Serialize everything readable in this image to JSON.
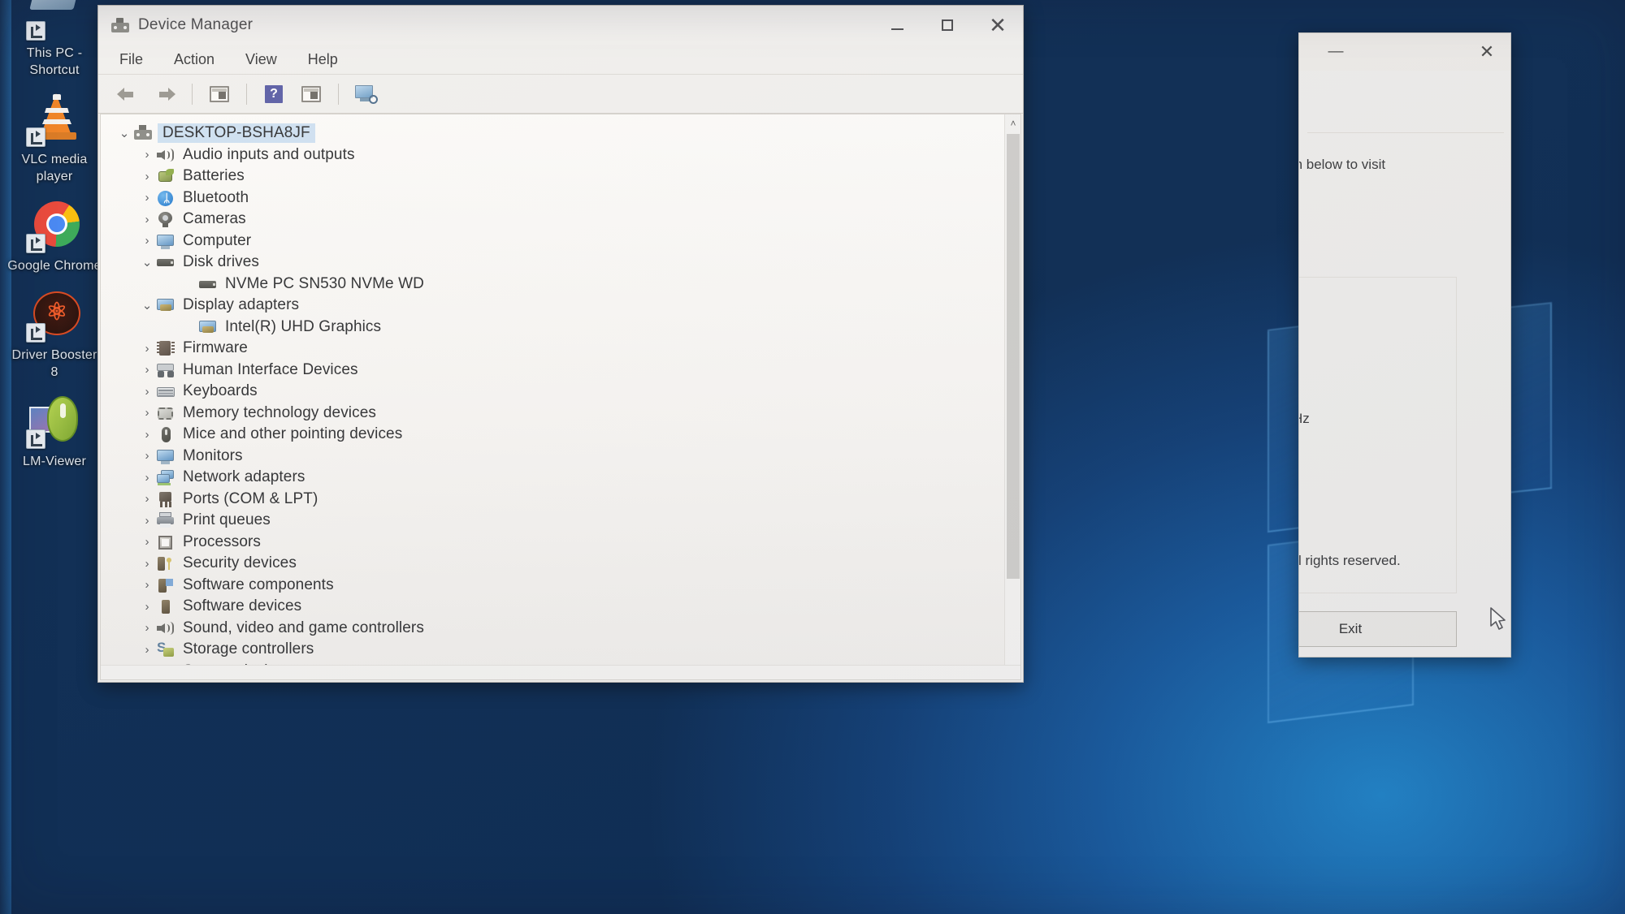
{
  "desktop": {
    "icons": [
      {
        "label": "This PC - Shortcut",
        "icon": "this-pc-icon"
      },
      {
        "label": "VLC media player",
        "icon": "vlc-icon"
      },
      {
        "label": "Google Chrome",
        "icon": "chrome-icon"
      },
      {
        "label": "Driver Booster 8",
        "icon": "driver-booster-icon"
      },
      {
        "label": "LM-Viewer",
        "icon": "lm-viewer-icon"
      }
    ]
  },
  "device_manager": {
    "title": "Device Manager",
    "title_icon": "device-manager-icon",
    "window_buttons": {
      "minimize": "—",
      "maximize": "□",
      "close": "✕"
    },
    "menu": [
      {
        "label": "File"
      },
      {
        "label": "Action"
      },
      {
        "label": "View"
      },
      {
        "label": "Help"
      }
    ],
    "toolbar": [
      {
        "name": "back-button",
        "icon": "back-arrow-icon"
      },
      {
        "name": "forward-button",
        "icon": "forward-arrow-icon"
      },
      {
        "name": "properties-button",
        "icon": "properties-icon"
      },
      {
        "name": "help-button",
        "icon": "help-icon"
      },
      {
        "name": "update-driver-button",
        "icon": "update-driver-icon"
      },
      {
        "name": "scan-hardware-button",
        "icon": "scan-hardware-icon"
      }
    ],
    "tree": [
      {
        "label": "DESKTOP-BSHA8JF",
        "level": 0,
        "state": "expanded",
        "icon": "computer-node-icon",
        "selected": true
      },
      {
        "label": "Audio inputs and outputs",
        "level": 1,
        "state": "collapsed",
        "icon": "speaker-icon"
      },
      {
        "label": "Batteries",
        "level": 1,
        "state": "collapsed",
        "icon": "battery-icon"
      },
      {
        "label": "Bluetooth",
        "level": 1,
        "state": "collapsed",
        "icon": "bluetooth-icon"
      },
      {
        "label": "Cameras",
        "level": 1,
        "state": "collapsed",
        "icon": "camera-icon"
      },
      {
        "label": "Computer",
        "level": 1,
        "state": "collapsed",
        "icon": "monitor-icon"
      },
      {
        "label": "Disk drives",
        "level": 1,
        "state": "expanded",
        "icon": "disk-icon"
      },
      {
        "label": "NVMe PC SN530 NVMe WD",
        "level": 2,
        "state": "leaf",
        "icon": "disk-icon"
      },
      {
        "label": "Display adapters",
        "level": 1,
        "state": "expanded",
        "icon": "display-adapter-icon"
      },
      {
        "label": "Intel(R) UHD Graphics",
        "level": 2,
        "state": "leaf",
        "icon": "display-adapter-icon"
      },
      {
        "label": "Firmware",
        "level": 1,
        "state": "collapsed",
        "icon": "chip-icon"
      },
      {
        "label": "Human Interface Devices",
        "level": 1,
        "state": "collapsed",
        "icon": "hid-icon"
      },
      {
        "label": "Keyboards",
        "level": 1,
        "state": "collapsed",
        "icon": "keyboard-icon"
      },
      {
        "label": "Memory technology devices",
        "level": 1,
        "state": "collapsed",
        "icon": "memory-technology-icon"
      },
      {
        "label": "Mice and other pointing devices",
        "level": 1,
        "state": "collapsed",
        "icon": "mouse-icon"
      },
      {
        "label": "Monitors",
        "level": 1,
        "state": "collapsed",
        "icon": "monitor-icon"
      },
      {
        "label": "Network adapters",
        "level": 1,
        "state": "collapsed",
        "icon": "network-adapter-icon"
      },
      {
        "label": "Ports (COM & LPT)",
        "level": 1,
        "state": "collapsed",
        "icon": "port-icon"
      },
      {
        "label": "Print queues",
        "level": 1,
        "state": "collapsed",
        "icon": "printer-icon"
      },
      {
        "label": "Processors",
        "level": 1,
        "state": "collapsed",
        "icon": "cpu-icon"
      },
      {
        "label": "Security devices",
        "level": 1,
        "state": "collapsed",
        "icon": "security-icon"
      },
      {
        "label": "Software components",
        "level": 1,
        "state": "collapsed",
        "icon": "software-component-icon"
      },
      {
        "label": "Software devices",
        "level": 1,
        "state": "collapsed",
        "icon": "software-device-icon"
      },
      {
        "label": "Sound, video and game controllers",
        "level": 1,
        "state": "collapsed",
        "icon": "speaker-icon"
      },
      {
        "label": "Storage controllers",
        "level": 1,
        "state": "collapsed",
        "icon": "storage-controller-icon"
      },
      {
        "label": "System devices",
        "level": 1,
        "state": "collapsed",
        "icon": "system-device-icon"
      }
    ],
    "twisty_glyphs": {
      "collapsed": "›",
      "expanded": "⌄"
    },
    "scrollbar": {
      "up": "˄",
      "down": "˅"
    }
  },
  "background_window": {
    "minimize": "—",
    "close": "✕",
    "text_visit": "\" button below to visit",
    "text_hz": "Hz",
    "text_rights": "soft. All rights reserved.",
    "exit_label": "Exit"
  },
  "colors": {
    "selection_blue": "#cfe1f2",
    "window_face": "#f1f0ee",
    "desktop_blue": "#1d4478",
    "text_dark": "#2f3032"
  }
}
